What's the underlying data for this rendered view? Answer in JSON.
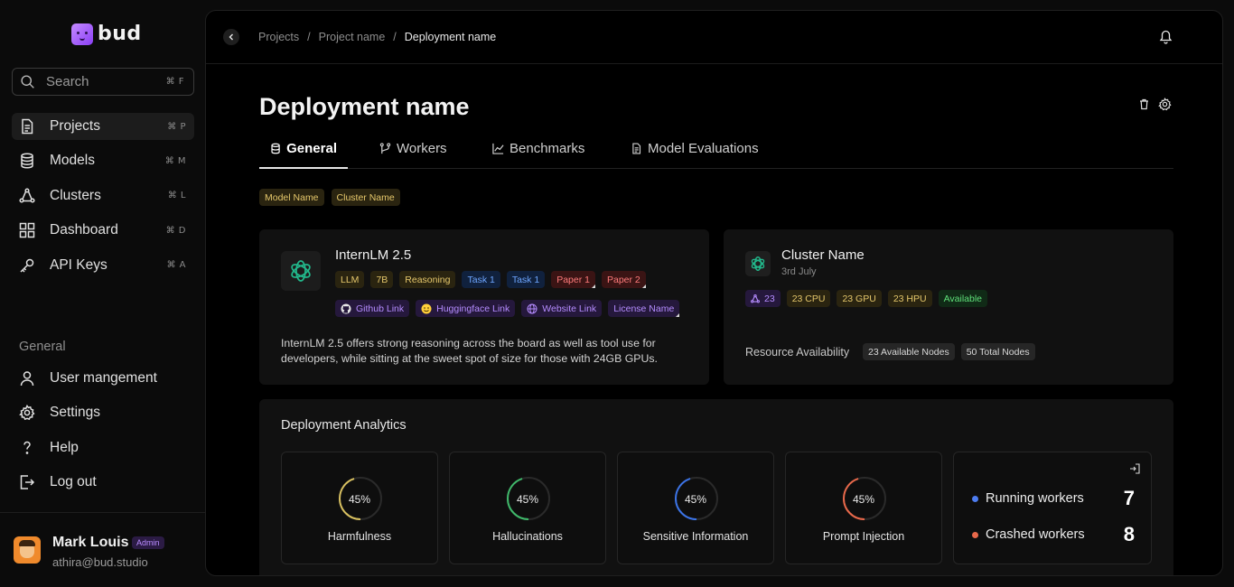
{
  "brand": {
    "name": "bud"
  },
  "search": {
    "placeholder": "Search",
    "shortcut": "⌘ F"
  },
  "sidebar": {
    "items": [
      {
        "label": "Projects",
        "shortcut": "⌘ P",
        "icon": "document-icon",
        "active": true
      },
      {
        "label": "Models",
        "shortcut": "⌘ M",
        "icon": "database-icon"
      },
      {
        "label": "Clusters",
        "shortcut": "⌘ L",
        "icon": "cluster-icon"
      },
      {
        "label": "Dashboard",
        "shortcut": "⌘ D",
        "icon": "grid-icon"
      },
      {
        "label": "API Keys",
        "shortcut": "⌘ A",
        "icon": "key-icon"
      }
    ],
    "section_title": "General",
    "general_items": [
      {
        "label": "User mangement",
        "icon": "user-icon"
      },
      {
        "label": "Settings",
        "icon": "gear-icon"
      },
      {
        "label": "Help",
        "icon": "question-icon"
      },
      {
        "label": "Log out",
        "icon": "logout-icon"
      }
    ]
  },
  "profile": {
    "name": "Mark Louis",
    "role": "Admin",
    "email": "athira@bud.studio"
  },
  "breadcrumb": {
    "items": [
      "Projects",
      "Project name",
      "Deployment name"
    ],
    "separator": "/"
  },
  "page": {
    "title": "Deployment name"
  },
  "tabs": [
    {
      "label": "General",
      "icon": "database-icon",
      "active": true
    },
    {
      "label": "Workers",
      "icon": "workers-icon"
    },
    {
      "label": "Benchmarks",
      "icon": "chart-line-icon"
    },
    {
      "label": "Model Evaluations",
      "icon": "document-icon"
    }
  ],
  "meta_chips": [
    "Model Name",
    "Cluster Name"
  ],
  "model": {
    "name": "InternLM 2.5",
    "tags": [
      {
        "label": "LLM",
        "color": "yellow"
      },
      {
        "label": "7B",
        "color": "yellow"
      },
      {
        "label": "Reasoning",
        "color": "yellow"
      },
      {
        "label": "Task 1",
        "color": "blue"
      },
      {
        "label": "Task 1",
        "color": "blue"
      },
      {
        "label": "Paper 1",
        "color": "red"
      },
      {
        "label": "Paper 2",
        "color": "red"
      }
    ],
    "links": [
      {
        "label": "Github Link",
        "icon": "github-icon"
      },
      {
        "label": "Huggingface Link",
        "icon": "huggingface-icon"
      },
      {
        "label": "Website Link",
        "icon": "globe-icon"
      },
      {
        "label": "License Name",
        "icon": ""
      }
    ],
    "description": "InternLM 2.5 offers strong reasoning across the board as well as tool use for developers, while sitting at the sweet spot of size for those with 24GB GPUs."
  },
  "cluster": {
    "name": "Cluster Name",
    "date": "3rd July",
    "tags": [
      {
        "label": "23",
        "color": "purple",
        "icon": "cluster-icon"
      },
      {
        "label": "23 CPU",
        "color": "yellow"
      },
      {
        "label": "23 GPU",
        "color": "yellow"
      },
      {
        "label": "23 HPU",
        "color": "yellow"
      },
      {
        "label": "Available",
        "color": "green"
      }
    ],
    "resource_label": "Resource Availability",
    "resource_chips": [
      "23 Available Nodes",
      "50 Total Nodes"
    ]
  },
  "analytics": {
    "title": "Deployment Analytics",
    "metrics": [
      {
        "label": "Harmfulness",
        "value": "45%",
        "percent": 45,
        "color": "#d8c060"
      },
      {
        "label": "Hallucinations",
        "value": "45%",
        "percent": 45,
        "color": "#3fb86a"
      },
      {
        "label": "Sensitive Information",
        "value": "45%",
        "percent": 45,
        "color": "#3b73e6"
      },
      {
        "label": "Prompt Injection",
        "value": "45%",
        "percent": 45,
        "color": "#e8684a"
      }
    ],
    "workers": [
      {
        "label": "Running workers",
        "value": "7",
        "color": "#4d7cf0"
      },
      {
        "label": "Crashed workers",
        "value": "8",
        "color": "#e8684a"
      }
    ]
  }
}
